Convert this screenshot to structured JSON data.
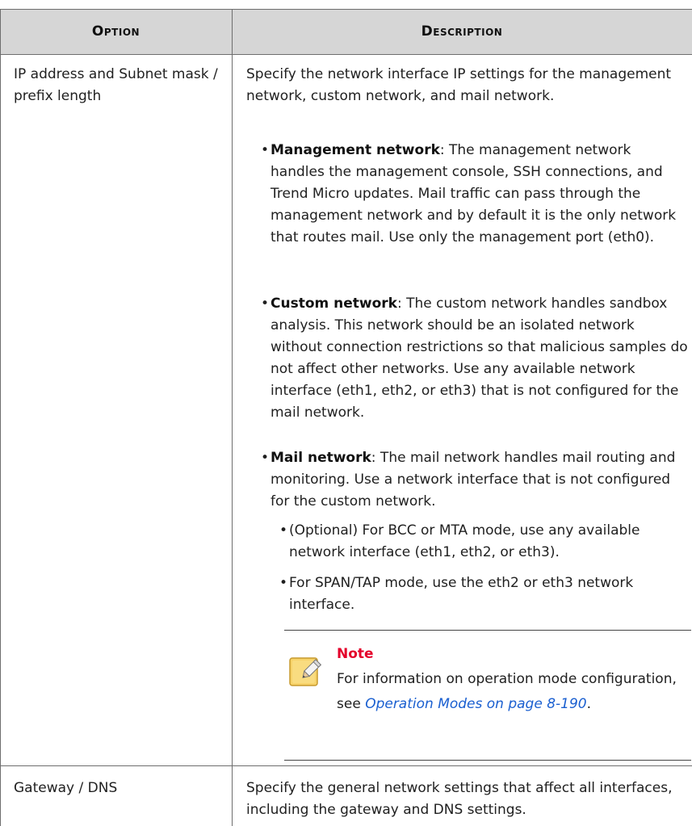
{
  "table": {
    "headers": {
      "option": "Option",
      "description": "Description"
    },
    "rows": [
      {
        "option": "IP address and Subnet mask / prefix length",
        "intro": "Specify the network interface IP settings for the management network, custom network, and mail network.",
        "bullets": [
          {
            "term": "Management network",
            "text": ": The management network handles the management console, SSH connections, and Trend Micro updates. Mail traffic can pass through the management network and by default it is the only network that routes mail. Use only the management port (eth0)."
          },
          {
            "term": "Custom network",
            "text": ": The custom network handles sandbox analysis. This network should be an isolated network without connection restrictions so that malicious samples do not affect other networks. Use any available network interface (eth1, eth2, or eth3) that is not configured for the mail network."
          },
          {
            "term": "Mail network",
            "text": ": The mail network handles mail routing and monitoring. Use a network interface that is not configured for the custom network.",
            "sub": [
              "(Optional) For BCC or MTA mode, use any available network interface (eth1, eth2, or eth3).",
              "For SPAN/TAP mode, use the eth2 or eth3 network interface."
            ]
          }
        ],
        "note": {
          "title": "Note",
          "text": "For information on operation mode configuration, see ",
          "link": "Operation Modes on page 8-190",
          "end": "."
        }
      },
      {
        "option": "Gateway / DNS",
        "intro": "Specify the general network settings that affect all interfaces, including the gateway and DNS settings."
      }
    ]
  }
}
